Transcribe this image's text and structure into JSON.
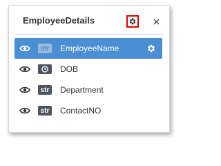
{
  "panel": {
    "title": "EmployeeDetails",
    "settings_icon": "gear-icon",
    "close_icon": "close-icon"
  },
  "fields": [
    {
      "label": "EmployeeName",
      "type_icon": "string-type-icon",
      "type_text": "str",
      "visible": true,
      "selected": true
    },
    {
      "label": "DOB",
      "type_icon": "clock-type-icon",
      "type_text": "",
      "visible": true,
      "selected": false
    },
    {
      "label": "Department",
      "type_icon": "string-type-icon",
      "type_text": "str",
      "visible": true,
      "selected": false
    },
    {
      "label": "ContactNO",
      "type_icon": "string-type-icon",
      "type_text": "str",
      "visible": true,
      "selected": false
    }
  ],
  "colors": {
    "selected_row": "#4a8fd3",
    "highlight_border": "#e00000",
    "badge": "#4d5660"
  }
}
